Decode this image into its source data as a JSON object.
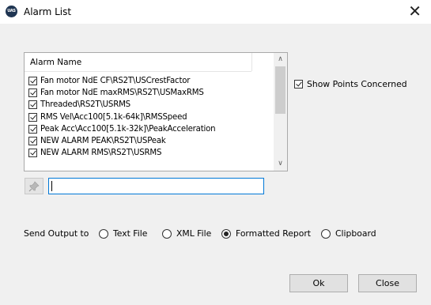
{
  "window": {
    "title": "Alarm List",
    "icon_text": "UAS"
  },
  "alarm_list": {
    "header": "Alarm Name",
    "items": [
      {
        "label": "Fan motor NdE CF\\RS2T\\USCrestFactor",
        "checked": true
      },
      {
        "label": "Fan motor NdE maxRMS\\RS2T\\USMaxRMS",
        "checked": true
      },
      {
        "label": "Threaded\\RS2T\\USRMS",
        "checked": true
      },
      {
        "label": "RMS Vel\\Acc100[5.1k-64k]\\RMSSpeed",
        "checked": true
      },
      {
        "label": "Peak Acc\\Acc100[5.1k-32k]\\PeakAcceleration",
        "checked": true
      },
      {
        "label": "NEW ALARM PEAK\\RS2T\\USPeak",
        "checked": true
      },
      {
        "label": "NEW ALARM RMS\\RS2T\\USRMS",
        "checked": true
      }
    ]
  },
  "show_points": {
    "label": "Show Points Concerned",
    "checked": true
  },
  "filter": {
    "value": ""
  },
  "output": {
    "label": "Send Output to",
    "options": [
      {
        "label": "Text File",
        "selected": false
      },
      {
        "label": "XML File",
        "selected": false
      },
      {
        "label": "Formatted Report",
        "selected": true
      },
      {
        "label": "Clipboard",
        "selected": false
      }
    ]
  },
  "buttons": {
    "ok": "Ok",
    "close": "Close"
  }
}
